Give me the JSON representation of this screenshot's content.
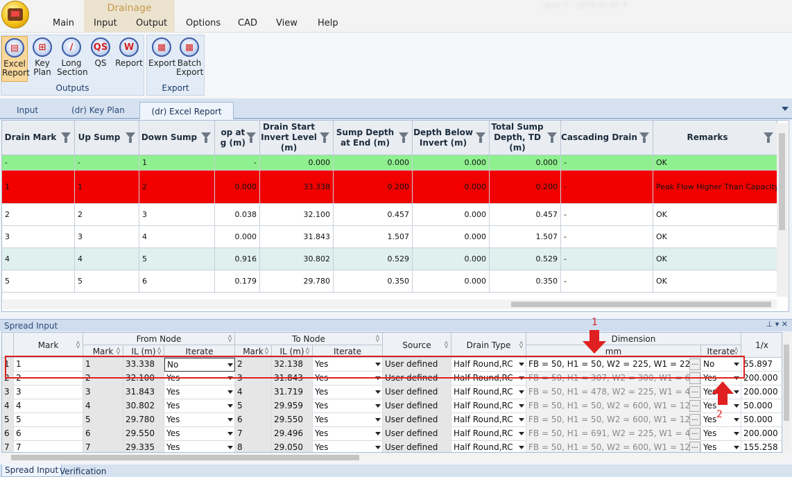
{
  "title_bar": {
    "obscured_text": "Level 1 - 3670 04 69 9"
  },
  "ribbon": {
    "context_group": "Drainage",
    "menu": [
      "Main",
      "Input",
      "Output",
      "Options",
      "CAD",
      "View",
      "Help"
    ],
    "outputs_buttons": [
      {
        "label": "Excel\nReport",
        "icon": "excel-report-icon",
        "glyph": "▤"
      },
      {
        "label": "Key\nPlan",
        "icon": "key-plan-icon",
        "glyph": "⊞"
      },
      {
        "label": "Long\nSection",
        "icon": "long-section-icon",
        "glyph": "∕"
      },
      {
        "label": "QS",
        "icon": "qs-icon",
        "glyph": "QS"
      },
      {
        "label": "Report",
        "icon": "report-icon",
        "glyph": "W"
      }
    ],
    "outputs_group_label": "Outputs",
    "export_buttons": [
      {
        "label": "Export",
        "icon": "export-icon",
        "glyph": "▦"
      },
      {
        "label": "Batch\nExport",
        "icon": "batch-export-icon",
        "glyph": "▦"
      }
    ],
    "export_group_label": "Export"
  },
  "doc_tabs": [
    "Input",
    "(dr) Key Plan",
    "(dr) Excel Report"
  ],
  "upper_grid": {
    "headers": [
      "Drain Mark",
      "Up Sump",
      "Down Sump",
      "op at\ng (m)",
      "Drain Start\nInvert Level\n(m)",
      "Sump Depth\nat End (m)",
      "Depth Below\nInvert (m)",
      "Total Sump\nDepth, TD\n(m)",
      "Cascading Drain",
      "Remarks"
    ],
    "rows": [
      {
        "bg": "#8ef08e",
        "cells": [
          "-",
          "-",
          "1",
          "-",
          "0.000",
          "0.000",
          "0.000",
          "0.000",
          "-",
          "OK"
        ]
      },
      {
        "bg": "#f20000",
        "cells": [
          "1",
          "1",
          "2",
          "0.000",
          "33.338",
          "0.200",
          "0.000",
          "0.200",
          "-",
          "Peak Flow Higher Than Capacity"
        ]
      },
      {
        "bg": "#ffffff",
        "cells": [
          "2",
          "2",
          "3",
          "0.038",
          "32.100",
          "0.457",
          "0.000",
          "0.457",
          "-",
          "OK"
        ]
      },
      {
        "bg": "#ffffff",
        "cells": [
          "3",
          "3",
          "4",
          "0.000",
          "31.843",
          "1.507",
          "0.000",
          "1.507",
          "-",
          "OK"
        ]
      },
      {
        "bg": "#dff0ef",
        "cells": [
          "4",
          "4",
          "5",
          "0.916",
          "30.802",
          "0.529",
          "0.000",
          "0.529",
          "-",
          "OK"
        ]
      },
      {
        "bg": "#ffffff",
        "cells": [
          "5",
          "5",
          "6",
          "0.179",
          "29.780",
          "0.350",
          "0.000",
          "0.350",
          "-",
          "OK"
        ]
      }
    ]
  },
  "spread_input": {
    "title": "Spread Input",
    "window_buttons": "▾ ✕",
    "headers": {
      "mark": "Mark",
      "from_node": "From Node",
      "to_node": "To Node",
      "source": "Source",
      "drain_type": "Drain Type",
      "dimension": "Dimension",
      "dimension_unit": "mm",
      "sub_mark": "Mark",
      "sub_il": "IL (m)",
      "sub_iterate": "Iterate",
      "iterate": "Iterate",
      "last": "1/x"
    },
    "rows": [
      {
        "idx": "1",
        "mark": "1",
        "from_mark": "1",
        "from_il": "33.338",
        "from_iter": "No",
        "to_mark": "2",
        "to_il": "32.138",
        "to_iter": "Yes",
        "source": "User defined",
        "type": "Half Round,RC",
        "dim": "FB = 50, H1 = 50, W2 = 225, W1 = 225",
        "iter": "No",
        "last": "55.897"
      },
      {
        "idx": "2",
        "mark": "2",
        "from_mark": "2",
        "from_il": "32.100",
        "from_iter": "Yes",
        "to_mark": "3",
        "to_il": "31.843",
        "to_iter": "Yes",
        "source": "User defined",
        "type": "Half Round,RC",
        "dim": "FB = 50, H1 = 307, W2 = 300, W1 = 600",
        "iter": "Yes",
        "last": "200.000"
      },
      {
        "idx": "3",
        "mark": "3",
        "from_mark": "3",
        "from_il": "31.843",
        "from_iter": "Yes",
        "to_mark": "4",
        "to_il": "31.719",
        "to_iter": "Yes",
        "source": "User defined",
        "type": "Half Round,RC",
        "dim": "FB = 50, H1 = 478, W2 = 225, W1 = 450",
        "iter": "Yes",
        "last": "200.000"
      },
      {
        "idx": "4",
        "mark": "4",
        "from_mark": "4",
        "from_il": "30.802",
        "from_iter": "Yes",
        "to_mark": "5",
        "to_il": "29.959",
        "to_iter": "Yes",
        "source": "User defined",
        "type": "Half Round,RC",
        "dim": "FB = 50, H1 = 50, W2 = 600, W1 = 1200",
        "iter": "Yes",
        "last": "50.000"
      },
      {
        "idx": "5",
        "mark": "5",
        "from_mark": "5",
        "from_il": "29.780",
        "from_iter": "Yes",
        "to_mark": "6",
        "to_il": "29.550",
        "to_iter": "Yes",
        "source": "User defined",
        "type": "Half Round,RC",
        "dim": "FB = 50, H1 = 50, W2 = 600, W1 = 1200",
        "iter": "Yes",
        "last": "50.000"
      },
      {
        "idx": "6",
        "mark": "6",
        "from_mark": "6",
        "from_il": "29.550",
        "from_iter": "Yes",
        "to_mark": "7",
        "to_il": "29.496",
        "to_iter": "Yes",
        "source": "User defined",
        "type": "Half Round,RC",
        "dim": "FB = 50, H1 = 691, W2 = 225, W1 = 450",
        "iter": "Yes",
        "last": "200.000"
      },
      {
        "idx": "7",
        "mark": "7",
        "from_mark": "7",
        "from_il": "29.335",
        "from_iter": "Yes",
        "to_mark": "8",
        "to_il": "29.050",
        "to_iter": "Yes",
        "source": "User defined",
        "type": "Half Round,RC",
        "dim": "FB = 50, H1 = 50, W2 = 600, W1 = 1200",
        "iter": "Yes",
        "last": "155.258"
      }
    ]
  },
  "bottom_tabs": [
    "Spread Input",
    "Verification"
  ],
  "annotations": {
    "label_1": "1",
    "label_2": "2",
    "color": "#e02020"
  }
}
